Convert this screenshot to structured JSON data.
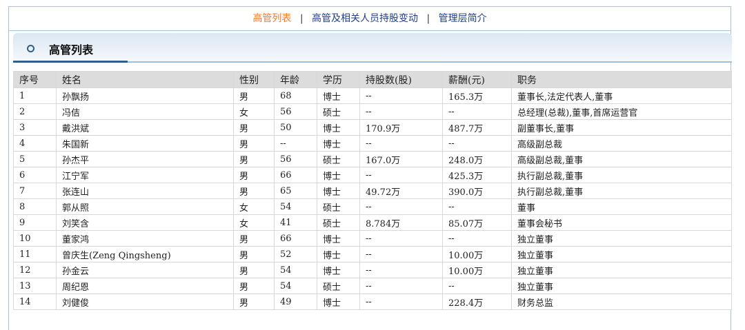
{
  "nav": {
    "active": "高管列表",
    "links": [
      "高管及相关人员持股变动",
      "管理层简介"
    ],
    "separator": "|"
  },
  "section_title": "高管列表",
  "table": {
    "headers": [
      "序号",
      "姓名",
      "性别",
      "年龄",
      "学历",
      "持股数(股)",
      "薪酬(元)",
      "职务"
    ],
    "rows": [
      [
        "1",
        "孙飘扬",
        "男",
        "68",
        "博士",
        "--",
        "165.3万",
        "董事长,法定代表人,董事"
      ],
      [
        "2",
        "冯佶",
        "女",
        "56",
        "硕士",
        "--",
        "--",
        "总经理(总裁),董事,首席运营官"
      ],
      [
        "3",
        "戴洪斌",
        "男",
        "50",
        "博士",
        "170.9万",
        "487.7万",
        "副董事长,董事"
      ],
      [
        "4",
        "朱国新",
        "男",
        "--",
        "博士",
        "--",
        "--",
        "高级副总裁"
      ],
      [
        "5",
        "孙杰平",
        "男",
        "56",
        "硕士",
        "167.0万",
        "248.0万",
        "高级副总裁,董事"
      ],
      [
        "6",
        "江宁军",
        "男",
        "66",
        "博士",
        "--",
        "425.3万",
        "执行副总裁,董事"
      ],
      [
        "7",
        "张连山",
        "男",
        "65",
        "博士",
        "49.72万",
        "390.0万",
        "执行副总裁,董事"
      ],
      [
        "8",
        "郭从照",
        "女",
        "54",
        "硕士",
        "--",
        "--",
        "董事"
      ],
      [
        "9",
        "刘笑含",
        "女",
        "41",
        "硕士",
        "8.784万",
        "85.07万",
        "董事会秘书"
      ],
      [
        "10",
        "董家鸿",
        "男",
        "66",
        "博士",
        "--",
        "--",
        "独立董事"
      ],
      [
        "11",
        "曾庆生(Zeng Qingsheng)",
        "男",
        "52",
        "博士",
        "--",
        "10.00万",
        "独立董事"
      ],
      [
        "12",
        "孙金云",
        "男",
        "54",
        "博士",
        "--",
        "10.00万",
        "独立董事"
      ],
      [
        "13",
        "周纪恩",
        "男",
        "54",
        "硕士",
        "--",
        "--",
        "独立董事"
      ],
      [
        "14",
        "刘健俊",
        "男",
        "49",
        "博士",
        "--",
        "228.4万",
        "财务总监"
      ]
    ]
  }
}
